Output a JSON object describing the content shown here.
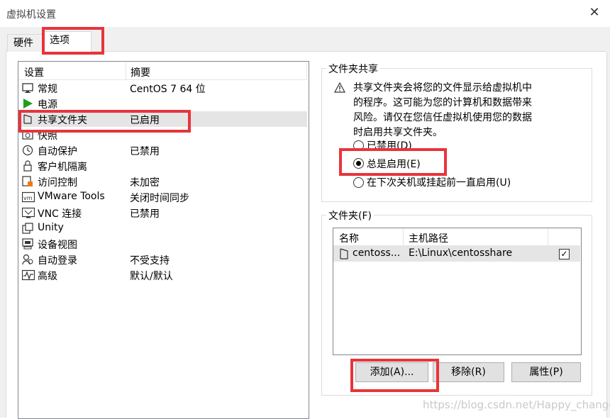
{
  "window": {
    "title": "虚拟机设置",
    "close_glyph": "✕"
  },
  "tabs": [
    {
      "label": "硬件",
      "active": false
    },
    {
      "label": "选项",
      "active": true
    }
  ],
  "settings_list": {
    "col_setting": "设置",
    "col_summary": "摘要",
    "rows": [
      {
        "name": "常规",
        "summary": "CentOS 7 64 位",
        "icon": "monitor-icon"
      },
      {
        "name": "电源",
        "summary": "",
        "icon": "power-play-icon"
      },
      {
        "name": "共享文件夹",
        "summary": "已启用",
        "icon": "shared-folder-icon",
        "selected": true
      },
      {
        "name": "快照",
        "summary": "",
        "icon": "snapshot-icon"
      },
      {
        "name": "自动保护",
        "summary": "已禁用",
        "icon": "autoprotect-clock-icon"
      },
      {
        "name": "客户机隔离",
        "summary": "",
        "icon": "lock-icon"
      },
      {
        "name": "访问控制",
        "summary": "未加密",
        "icon": "access-control-icon"
      },
      {
        "name": "VMware Tools",
        "summary": "关闭时间同步",
        "icon": "vmware-tools-icon"
      },
      {
        "name": "VNC 连接",
        "summary": "已禁用",
        "icon": "vnc-icon"
      },
      {
        "name": "Unity",
        "summary": "",
        "icon": "unity-icon"
      },
      {
        "name": "设备视图",
        "summary": "",
        "icon": "device-view-icon"
      },
      {
        "name": "自动登录",
        "summary": "不受支持",
        "icon": "auto-login-icon"
      },
      {
        "name": "高级",
        "summary": "默认/默认",
        "icon": "advanced-icon"
      }
    ]
  },
  "folder_sharing": {
    "group_title": "文件夹共享",
    "warning_text_lines": [
      "共享文件夹会将您的文件显示给虚拟机中",
      "的程序。这可能为您的计算机和数据带来",
      "风险。请仅在您信任虚拟机使用您的数据",
      "时启用共享文件夹。"
    ],
    "options": [
      {
        "label": "已禁用(D)",
        "selected": false
      },
      {
        "label": "总是启用(E)",
        "selected": true
      },
      {
        "label": "在下次关机或挂起前一直启用(U)",
        "selected": false
      }
    ]
  },
  "folders": {
    "group_title": "文件夹(F)",
    "col_name": "名称",
    "col_host_path": "主机路径",
    "rows": [
      {
        "name": "centoss...",
        "host_path": "E:\\Linux\\centosshare",
        "enabled": true
      }
    ],
    "add_button": "添加(A)...",
    "remove_button": "移除(R)",
    "properties_button": "属性(P)"
  },
  "watermark": "https://blog.csdn.net/Happy_change",
  "colors": {
    "highlight_box": "#e8343b",
    "selection": "#e5e5e5"
  }
}
